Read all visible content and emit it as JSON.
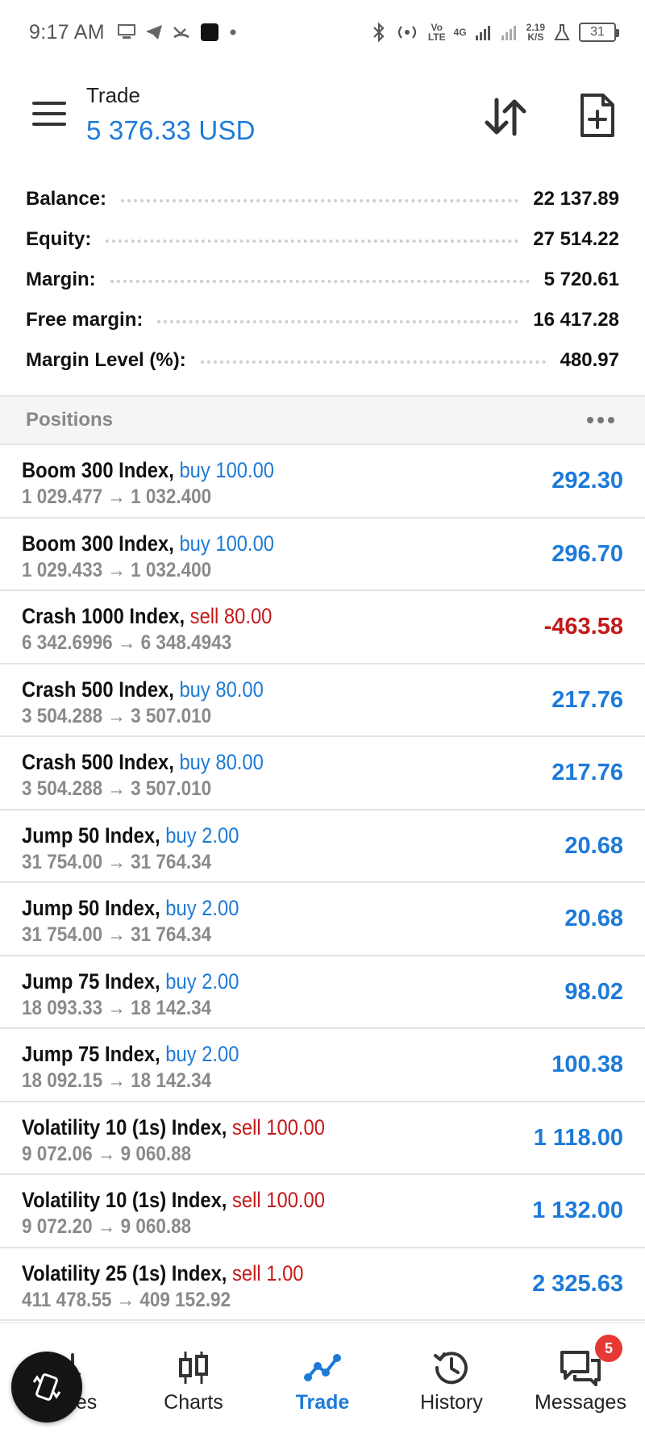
{
  "status_bar": {
    "time": "9:17 AM",
    "network_top": "Vo",
    "network_bottom": "LTE",
    "gen_top": "4G",
    "speed_top": "2.19",
    "speed_bottom": "K/S",
    "battery": "31"
  },
  "header": {
    "title": "Trade",
    "amount": "5 376.33 USD"
  },
  "summary": [
    {
      "label": "Balance:",
      "value": "22 137.89"
    },
    {
      "label": "Equity:",
      "value": "27 514.22"
    },
    {
      "label": "Margin:",
      "value": "5 720.61"
    },
    {
      "label": "Free margin:",
      "value": "16 417.28"
    },
    {
      "label": "Margin Level (%):",
      "value": "480.97"
    }
  ],
  "positions_title": "Positions",
  "positions": [
    {
      "symbol": "Boom 300 Index,",
      "dir": "buy",
      "direction": "buy 100.00",
      "prices": "1 029.477 → 1 032.400",
      "profit": "292.30"
    },
    {
      "symbol": "Boom 300 Index,",
      "dir": "buy",
      "direction": "buy 100.00",
      "prices": "1 029.433 → 1 032.400",
      "profit": "296.70"
    },
    {
      "symbol": "Crash 1000 Index,",
      "dir": "sell",
      "direction": "sell 80.00",
      "prices": "6 342.6996 → 6 348.4943",
      "profit": "-463.58"
    },
    {
      "symbol": "Crash 500 Index,",
      "dir": "buy",
      "direction": "buy 80.00",
      "prices": "3 504.288 → 3 507.010",
      "profit": "217.76"
    },
    {
      "symbol": "Crash 500 Index,",
      "dir": "buy",
      "direction": "buy 80.00",
      "prices": "3 504.288 → 3 507.010",
      "profit": "217.76"
    },
    {
      "symbol": "Jump 50 Index,",
      "dir": "buy",
      "direction": "buy 2.00",
      "prices": "31 754.00 → 31 764.34",
      "profit": "20.68"
    },
    {
      "symbol": "Jump 50 Index,",
      "dir": "buy",
      "direction": "buy 2.00",
      "prices": "31 754.00 → 31 764.34",
      "profit": "20.68"
    },
    {
      "symbol": "Jump 75 Index,",
      "dir": "buy",
      "direction": "buy 2.00",
      "prices": "18 093.33 → 18 142.34",
      "profit": "98.02"
    },
    {
      "symbol": "Jump 75 Index,",
      "dir": "buy",
      "direction": "buy 2.00",
      "prices": "18 092.15 → 18 142.34",
      "profit": "100.38"
    },
    {
      "symbol": "Volatility 10 (1s) Index,",
      "dir": "sell",
      "direction": "sell 100.00",
      "prices": "9 072.06 → 9 060.88",
      "profit": "1 118.00"
    },
    {
      "symbol": "Volatility 10 (1s) Index,",
      "dir": "sell",
      "direction": "sell 100.00",
      "prices": "9 072.20 → 9 060.88",
      "profit": "1 132.00"
    },
    {
      "symbol": "Volatility 25 (1s) Index,",
      "dir": "sell",
      "direction": "sell 1.00",
      "prices": "411 478.55 → 409 152.92",
      "profit": "2 325.63"
    }
  ],
  "nav": [
    {
      "label": "Quotes",
      "icon": "quotes-icon"
    },
    {
      "label": "Charts",
      "icon": "charts-icon"
    },
    {
      "label": "Trade",
      "icon": "trade-icon",
      "active": true
    },
    {
      "label": "History",
      "icon": "history-icon"
    },
    {
      "label": "Messages",
      "icon": "messages-icon",
      "badge": "5"
    }
  ],
  "colors": {
    "accent": "#1d7ad8",
    "negative": "#c41a1a",
    "badge": "#e53935"
  }
}
